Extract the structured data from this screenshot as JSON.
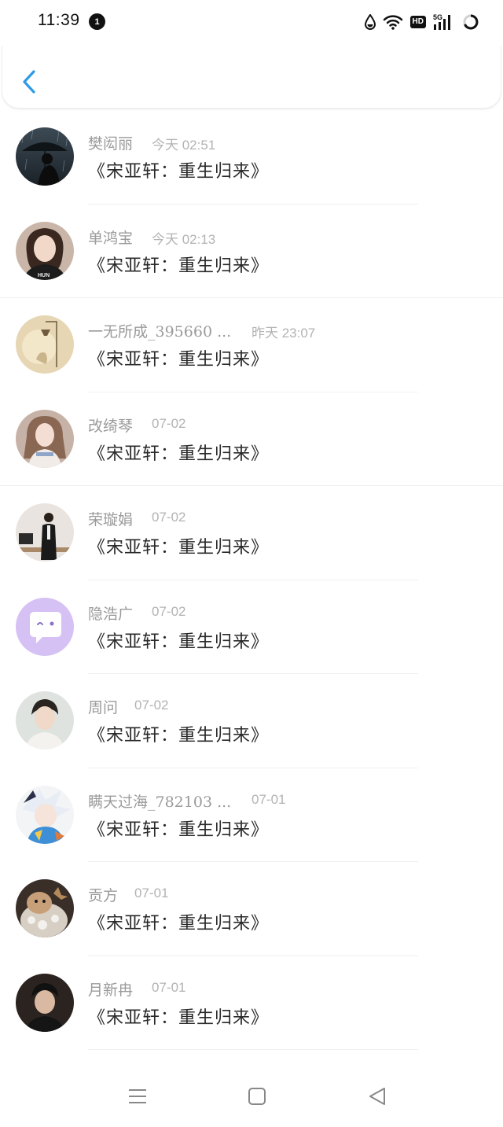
{
  "status_bar": {
    "time": "11:39",
    "notification_count": "1",
    "hd_label": "HD",
    "network_label": "5G",
    "icons": [
      "water-drop-icon",
      "wifi-icon",
      "hd-icon",
      "signal-5g-icon",
      "battery-ring-icon"
    ]
  },
  "header": {
    "back_icon": "chevron-left-icon",
    "accent_color": "#2d9be6"
  },
  "messages": [
    {
      "name": "樊闳丽",
      "time": "今天 02:51",
      "text": "《宋亚轩：重生归来》",
      "avatar": "photo-rain-umbrella"
    },
    {
      "name": "单鸿宝",
      "time": "今天 02:13",
      "text": "《宋亚轩：重生归来》",
      "avatar": "photo-girl-black-shirt"
    },
    {
      "name": "一无所成_395660 ...",
      "time": "昨天 23:07",
      "text": "《宋亚轩：重生归来》",
      "avatar": "illustration-lamp"
    },
    {
      "name": "改绮琴",
      "time": "07-02",
      "text": "《宋亚轩：重生归来》",
      "avatar": "photo-girl-pigtails"
    },
    {
      "name": "荣璇娟",
      "time": "07-02",
      "text": "《宋亚轩：重生归来》",
      "avatar": "photo-man-office"
    },
    {
      "name": "隐浩广",
      "time": "07-02",
      "text": "《宋亚轩：重生归来》",
      "avatar": "default-chat-bubble"
    },
    {
      "name": "周问",
      "time": "07-02",
      "text": "《宋亚轩：重生归来》",
      "avatar": "photo-boy-portrait"
    },
    {
      "name": "瞒天过海_782103 ...",
      "time": "07-01",
      "text": "《宋亚轩：重生归来》",
      "avatar": "anime-white-hair"
    },
    {
      "name": "贡方",
      "time": "07-01",
      "text": "《宋亚轩：重生归来》",
      "avatar": "photo-bear-toy"
    },
    {
      "name": "月新冉",
      "time": "07-01",
      "text": "《宋亚轩：重生归来》",
      "avatar": "photo-boy-dark"
    }
  ],
  "nav_bar": {
    "icons": [
      "menu-icon",
      "home-square-icon",
      "back-triangle-icon"
    ]
  }
}
